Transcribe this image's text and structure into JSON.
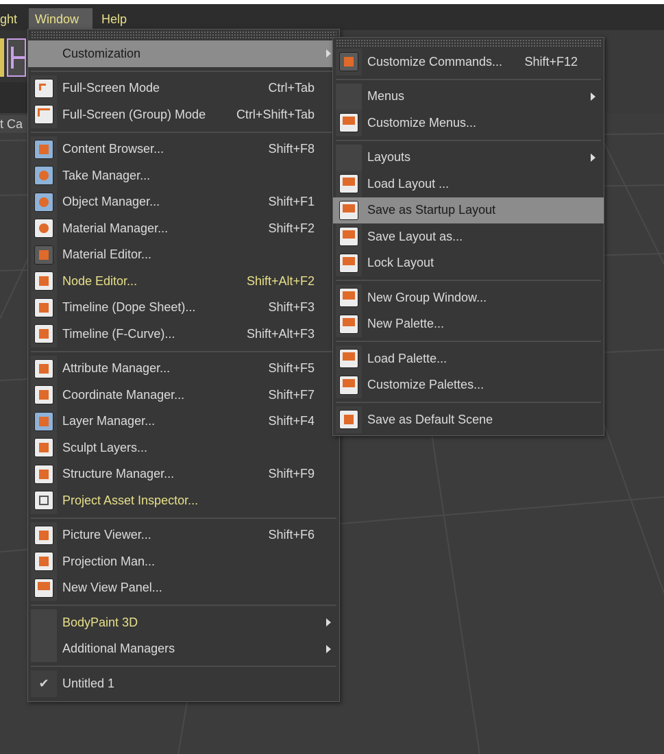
{
  "menubar": {
    "items": [
      {
        "label": "ght"
      },
      {
        "label": "Window"
      },
      {
        "label": "Help"
      }
    ]
  },
  "viewport": {
    "label": "t Ca"
  },
  "window_menu": {
    "items": [
      {
        "type": "submenu",
        "label": "Customization",
        "highlight": true
      },
      {
        "type": "sep"
      },
      {
        "type": "item",
        "label": "Full-Screen Mode",
        "shortcut": "Ctrl+Tab",
        "icon": "fullscreen-icon"
      },
      {
        "type": "item",
        "label": "Full-Screen (Group) Mode",
        "shortcut": "Ctrl+Shift+Tab",
        "icon": "fullscreen-group-icon"
      },
      {
        "type": "sep"
      },
      {
        "type": "item",
        "label": "Content Browser...",
        "shortcut": "Shift+F8",
        "icon": "content-browser-icon"
      },
      {
        "type": "item",
        "label": "Take Manager...",
        "shortcut": "",
        "icon": "take-manager-icon"
      },
      {
        "type": "item",
        "label": "Object Manager...",
        "shortcut": "Shift+F1",
        "icon": "object-manager-icon"
      },
      {
        "type": "item",
        "label": "Material Manager...",
        "shortcut": "Shift+F2",
        "icon": "material-manager-icon"
      },
      {
        "type": "item",
        "label": "Material Editor...",
        "shortcut": "",
        "icon": "material-editor-icon"
      },
      {
        "type": "item",
        "label": "Node Editor...",
        "shortcut": "Shift+Alt+F2",
        "icon": "node-editor-icon",
        "yellow": true
      },
      {
        "type": "item",
        "label": "Timeline (Dope Sheet)...",
        "shortcut": "Shift+F3",
        "icon": "timeline-dope-sheet-icon"
      },
      {
        "type": "item",
        "label": "Timeline (F-Curve)...",
        "shortcut": "Shift+Alt+F3",
        "icon": "timeline-fcurve-icon"
      },
      {
        "type": "sep"
      },
      {
        "type": "item",
        "label": "Attribute Manager...",
        "shortcut": "Shift+F5",
        "icon": "attribute-manager-icon"
      },
      {
        "type": "item",
        "label": "Coordinate Manager...",
        "shortcut": "Shift+F7",
        "icon": "coordinate-manager-icon"
      },
      {
        "type": "item",
        "label": "Layer Manager...",
        "shortcut": "Shift+F4",
        "icon": "layer-manager-icon"
      },
      {
        "type": "item",
        "label": "Sculpt Layers...",
        "shortcut": "",
        "icon": "sculpt-layers-icon"
      },
      {
        "type": "item",
        "label": "Structure Manager...",
        "shortcut": "Shift+F9",
        "icon": "structure-manager-icon"
      },
      {
        "type": "item",
        "label": "Project Asset Inspector...",
        "shortcut": "",
        "icon": "project-asset-inspector-icon",
        "yellow": true
      },
      {
        "type": "sep"
      },
      {
        "type": "item",
        "label": "Picture Viewer...",
        "shortcut": "Shift+F6",
        "icon": "picture-viewer-icon"
      },
      {
        "type": "item",
        "label": "Projection Man...",
        "shortcut": "",
        "icon": "projection-man-icon"
      },
      {
        "type": "item",
        "label": "New View Panel...",
        "shortcut": "",
        "icon": "new-view-panel-icon"
      },
      {
        "type": "sep"
      },
      {
        "type": "submenu",
        "label": "BodyPaint 3D",
        "yellow": true
      },
      {
        "type": "submenu",
        "label": "Additional Managers"
      },
      {
        "type": "sep"
      },
      {
        "type": "check",
        "label": "Untitled 1"
      }
    ]
  },
  "customization_menu": {
    "items": [
      {
        "type": "item",
        "label": "Customize Commands...",
        "shortcut": "Shift+F12",
        "icon": "customize-commands-icon"
      },
      {
        "type": "sep"
      },
      {
        "type": "submenu",
        "label": "Menus"
      },
      {
        "type": "item",
        "label": "Customize Menus...",
        "shortcut": "",
        "icon": "customize-menus-icon"
      },
      {
        "type": "sep"
      },
      {
        "type": "submenu",
        "label": "Layouts"
      },
      {
        "type": "item",
        "label": "Load Layout ...",
        "shortcut": "",
        "icon": "load-layout-icon"
      },
      {
        "type": "item",
        "label": "Save as Startup Layout",
        "shortcut": "",
        "icon": "save-startup-layout-icon",
        "highlight": true
      },
      {
        "type": "item",
        "label": "Save Layout as...",
        "shortcut": "",
        "icon": "save-layout-as-icon"
      },
      {
        "type": "item",
        "label": "Lock Layout",
        "shortcut": "",
        "icon": "lock-layout-icon"
      },
      {
        "type": "sep"
      },
      {
        "type": "item",
        "label": "New Group Window...",
        "shortcut": "",
        "icon": "new-group-window-icon"
      },
      {
        "type": "item",
        "label": "New Palette...",
        "shortcut": "",
        "icon": "new-palette-icon"
      },
      {
        "type": "sep"
      },
      {
        "type": "item",
        "label": "Load Palette...",
        "shortcut": "",
        "icon": "load-palette-icon"
      },
      {
        "type": "item",
        "label": "Customize Palettes...",
        "shortcut": "",
        "icon": "customize-palettes-icon"
      },
      {
        "type": "sep"
      },
      {
        "type": "item",
        "label": "Save as Default Scene",
        "shortcut": "",
        "icon": "save-default-scene-icon"
      }
    ]
  }
}
